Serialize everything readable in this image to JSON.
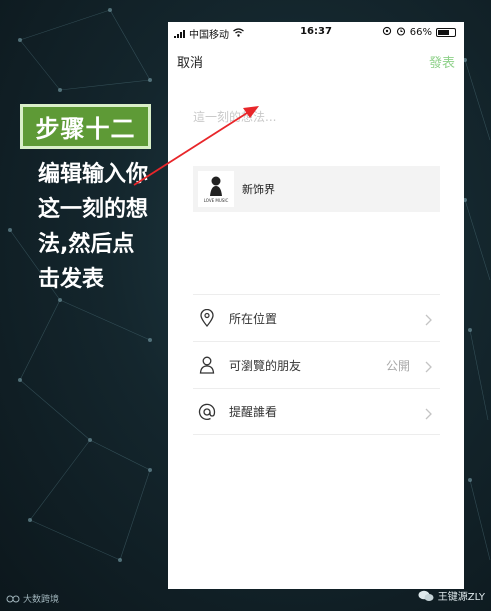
{
  "step": {
    "badge_label": "步骤十二"
  },
  "instruction": {
    "text": "编辑输入你这一刻的想法,然后点击发表"
  },
  "status_bar": {
    "carrier": "中国移动",
    "time": "16:37",
    "battery": "66%"
  },
  "top_bar": {
    "cancel_label": "取消",
    "publish_label": "發表"
  },
  "composer": {
    "placeholder": "這一刻的想法..."
  },
  "music_card": {
    "cover_label": "LOVE MUSIC",
    "title": "新饰界"
  },
  "options": [
    {
      "icon": "location-pin-icon",
      "label": "所在位置",
      "value": ""
    },
    {
      "icon": "person-icon",
      "label": "可瀏覽的朋友",
      "value": "公開"
    },
    {
      "icon": "at-sign-icon",
      "label": "提醒誰看",
      "value": ""
    }
  ],
  "watermarks": {
    "left": "大数跨境",
    "right": "王键源ZLY"
  },
  "colors": {
    "badge_green": "#5e9a36",
    "publish_green": "#8fd18a",
    "arrow_red": "#e8262a"
  }
}
